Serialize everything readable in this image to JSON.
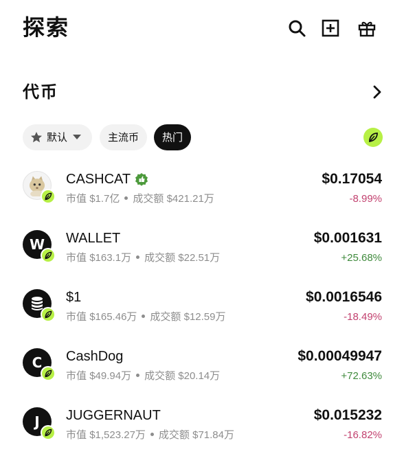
{
  "header": {
    "title": "探索",
    "icons": [
      "search-icon",
      "add-square-icon",
      "gift-icon"
    ]
  },
  "section": {
    "title": "代币"
  },
  "filters": {
    "default_label": "默认",
    "main_label": "主流币",
    "hot_label": "热门",
    "selected": "热门"
  },
  "colors": {
    "accent_green": "#b7f046",
    "negative": "#c2416f",
    "positive": "#3f8a3c"
  },
  "meta_labels": {
    "market_cap": "市值",
    "volume": "成交额"
  },
  "tokens": [
    {
      "name": "CASHCAT",
      "avatar": "cat-image",
      "verified": true,
      "market_cap": "$1.7亿",
      "volume": "$421.21万",
      "price": "$0.17054",
      "change": "-8.99%"
    },
    {
      "name": "WALLET",
      "avatar_letter": "W",
      "verified": false,
      "market_cap": "$163.1万",
      "volume": "$22.51万",
      "price": "$0.001631",
      "change": "+25.68%"
    },
    {
      "name": "$1",
      "avatar": "coin-stack-icon",
      "verified": false,
      "market_cap": "$165.46万",
      "volume": "$12.59万",
      "price": "$0.0016546",
      "change": "-18.49%"
    },
    {
      "name": "CashDog",
      "avatar_letter": "C",
      "verified": false,
      "market_cap": "$49.94万",
      "volume": "$20.14万",
      "price": "$0.00049947",
      "change": "+72.63%"
    },
    {
      "name": "JUGGERNAUT",
      "avatar_letter": "J",
      "verified": false,
      "market_cap": "$1,523.27万",
      "volume": "$71.84万",
      "price": "$0.015232",
      "change": "-16.82%"
    }
  ]
}
